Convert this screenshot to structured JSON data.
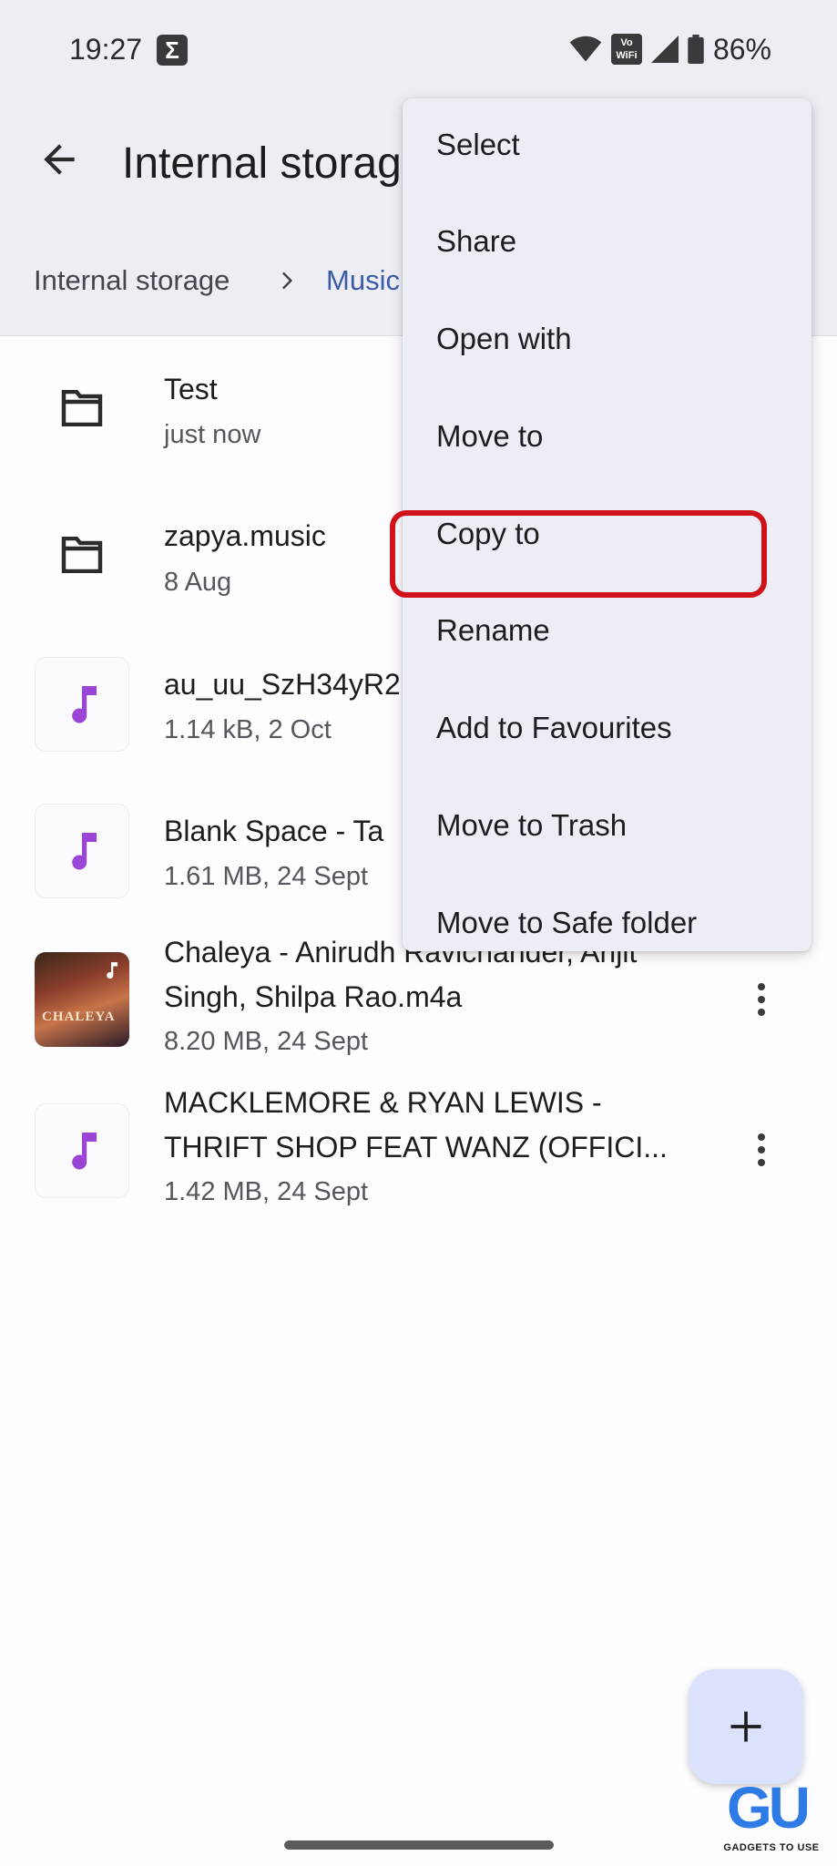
{
  "status_bar": {
    "time": "19:27",
    "battery": "86%",
    "vowifi": "Vo WiFi"
  },
  "app_bar": {
    "title": "Internal storage"
  },
  "breadcrumb": {
    "items": [
      "Internal storage",
      "Music"
    ]
  },
  "files": [
    {
      "name": "Test",
      "meta": "just now",
      "kind": "folder"
    },
    {
      "name": "zapya.music",
      "meta": "8 Aug",
      "kind": "folder"
    },
    {
      "name": "au_uu_SzH34yR2",
      "meta": "1.14 kB, 2 Oct",
      "kind": "audio"
    },
    {
      "name": "Blank Space - Ta",
      "meta": "1.61 MB, 24 Sept",
      "kind": "audio"
    },
    {
      "name_line1": "Chaleya - Anirudh Ravichander, Arijit",
      "name_line2": "Singh, Shilpa Rao.m4a",
      "meta": "8.20 MB, 24 Sept",
      "kind": "audio-art",
      "art_title": "CHALEYA"
    },
    {
      "name_line1": "MACKLEMORE & RYAN LEWIS -",
      "name_line2": "THRIFT SHOP FEAT WANZ (OFFICI...",
      "meta": "1.42 MB, 24 Sept",
      "kind": "audio"
    }
  ],
  "menu": {
    "items": [
      "Select",
      "Share",
      "Open with",
      "Move to",
      "Copy to",
      "Rename",
      "Add to Favourites",
      "Move to Trash",
      "Move to Safe folder"
    ],
    "highlighted": "Copy to"
  },
  "watermark": {
    "text": "GADGETS TO USE",
    "logo": "GU"
  },
  "colors": {
    "accent": "#3b5ba9",
    "music_icon": "#9b45d6",
    "highlight": "#d0121b",
    "fab": "#dbe2fb"
  }
}
